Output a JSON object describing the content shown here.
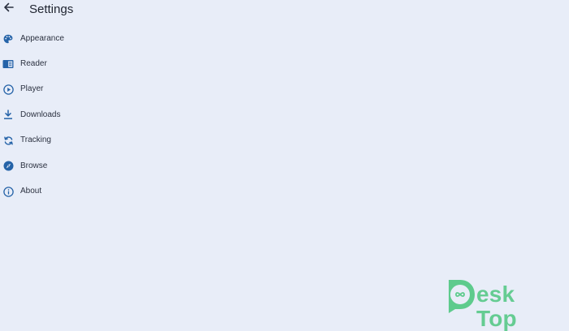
{
  "header": {
    "title": "Settings",
    "back_icon": "back-arrow-icon"
  },
  "colors": {
    "background": "#e8edf8",
    "accent": "#2563a8",
    "watermark": "#5ecb8d"
  },
  "menu": {
    "items": [
      {
        "label": "Appearance",
        "icon": "palette-icon"
      },
      {
        "label": "Reader",
        "icon": "book-icon"
      },
      {
        "label": "Player",
        "icon": "play-circle-icon"
      },
      {
        "label": "Downloads",
        "icon": "download-icon"
      },
      {
        "label": "Tracking",
        "icon": "sync-icon"
      },
      {
        "label": "Browse",
        "icon": "compass-icon"
      },
      {
        "label": "About",
        "icon": "info-icon"
      }
    ]
  },
  "watermark": {
    "text": "esk Top",
    "brand": "DeskTop"
  }
}
